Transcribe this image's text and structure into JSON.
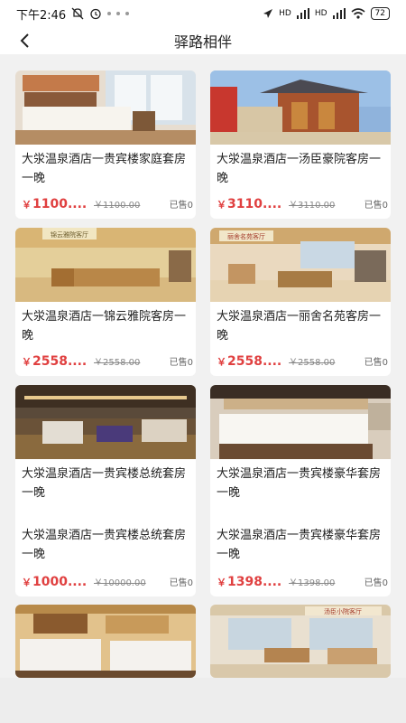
{
  "status_bar": {
    "time": "下午2:46",
    "signal_1": "HD",
    "signal_2": "HD",
    "battery": "72"
  },
  "header": {
    "title": "驿路相伴"
  },
  "products": [
    {
      "title": "大泶温泉酒店一贵宾楼家庭套房一晚",
      "price": "1100....",
      "original_price": "￥1100.00",
      "sold": "已售0",
      "currency": "￥"
    },
    {
      "title": "大泶温泉酒店一汤臣豪院客房一晚",
      "price": "3110....",
      "original_price": "￥3110.00",
      "sold": "已售0",
      "currency": "￥"
    },
    {
      "title": "大泶温泉酒店一锦云雅院客房一晚",
      "price": "2558....",
      "original_price": "￥2558.00",
      "sold": "已售0",
      "currency": "￥"
    },
    {
      "title": "大泶温泉酒店一丽舍名苑客房一晚",
      "price": "2558....",
      "original_price": "￥2558.00",
      "sold": "已售0",
      "currency": "￥"
    },
    {
      "title": "大泶温泉酒店一贵宾楼总统套房一晚",
      "price": "1000....",
      "original_price": "￥10000.00",
      "sold": "已售0",
      "currency": "￥"
    },
    {
      "title": "大泶温泉酒店一贵宾楼豪华套房一晚",
      "price": "1398....",
      "original_price": "￥1398.00",
      "sold": "已售0",
      "currency": "￥"
    }
  ],
  "image_signs": {
    "card2": "锦云雅院客厅",
    "card3": "丽舍名苑客厅",
    "card5": "汤臣小院客厅"
  }
}
